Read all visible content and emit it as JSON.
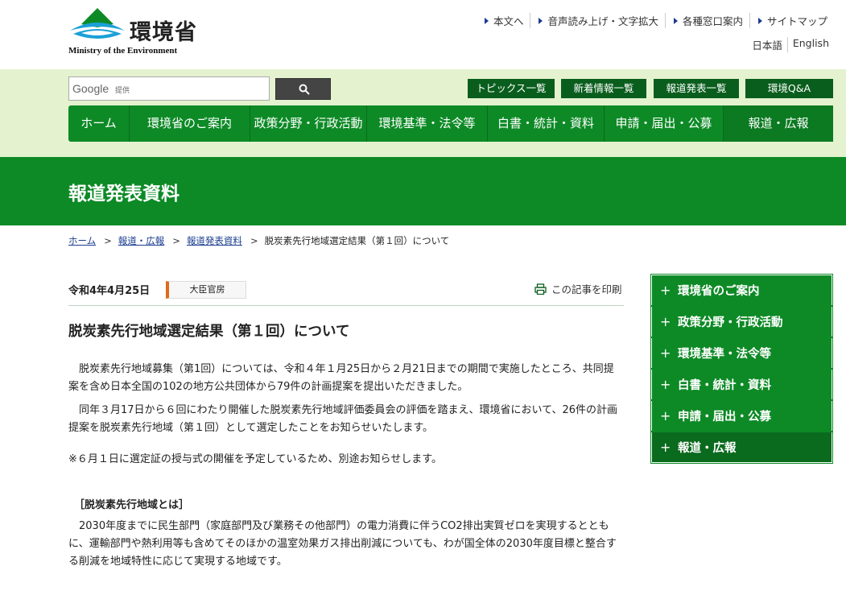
{
  "header": {
    "logo_jp": "環境省",
    "logo_en": "Ministry of the Environment",
    "util_links": [
      "本文へ",
      "音声読み上げ・文字拡大",
      "各種窓口案内",
      "サイトマップ"
    ],
    "languages": [
      "日本語",
      "English"
    ]
  },
  "search": {
    "google_label": "Google",
    "provided_label": "提供"
  },
  "quick_links": [
    "トピックス一覧",
    "新着情報一覧",
    "報道発表一覧",
    "環境Q&A"
  ],
  "global_nav": [
    "ホーム",
    "環境省のご案内",
    "政策分野・行政活動",
    "環境基準・法令等",
    "白書・統計・資料",
    "申請・届出・公募",
    "報道・広報"
  ],
  "page_title": "報道発表資料",
  "breadcrumb": {
    "links": [
      "ホーム",
      "報道・広報",
      "報道発表資料"
    ],
    "current": "脱炭素先行地域選定結果（第１回）について"
  },
  "article": {
    "date": "令和4年4月25日",
    "department": "大臣官房",
    "print_label": "この記事を印刷",
    "title": "脱炭素先行地域選定結果（第１回）について",
    "para1": "　脱炭素先行地域募集（第1回）については、令和４年１月25日から２月21日までの期間で実施したところ、共同提案を含め日本全国の102の地方公共団体から79件の計画提案を提出いただきました。",
    "para2": "　同年３月17日から６回にわたり開催した脱炭素先行地域評価委員会の評価を踏まえ、環境省において、26件の計画提案を脱炭素先行地域（第１回）として選定したことをお知らせいたします。",
    "note": "※６月１日に選定証の授与式の開催を予定しているため、別途お知らせします。",
    "subheading": "［脱炭素先行地域とは］",
    "para3": "　2030年度までに民生部門（家庭部門及び業務その他部門）の電力消費に伴うCO2排出実質ゼロを実現するとともに、運輸部門や熱利用等も含めてそのほかの温室効果ガス排出削減についても、わが国全体の2030年度目標と整合する削減を地域特性に応じて実現する地域です。"
  },
  "side_nav": [
    "環境省のご案内",
    "政策分野・行政活動",
    "環境基準・法令等",
    "白書・統計・資料",
    "申請・届出・公募",
    "報道・広報"
  ],
  "colors": {
    "brand_green": "#0d8a26",
    "dark_green": "#0a5e1d",
    "light_green_band": "#e4f2cf",
    "link_blue": "#1a3d8f",
    "dept_accent": "#e06a1b"
  }
}
